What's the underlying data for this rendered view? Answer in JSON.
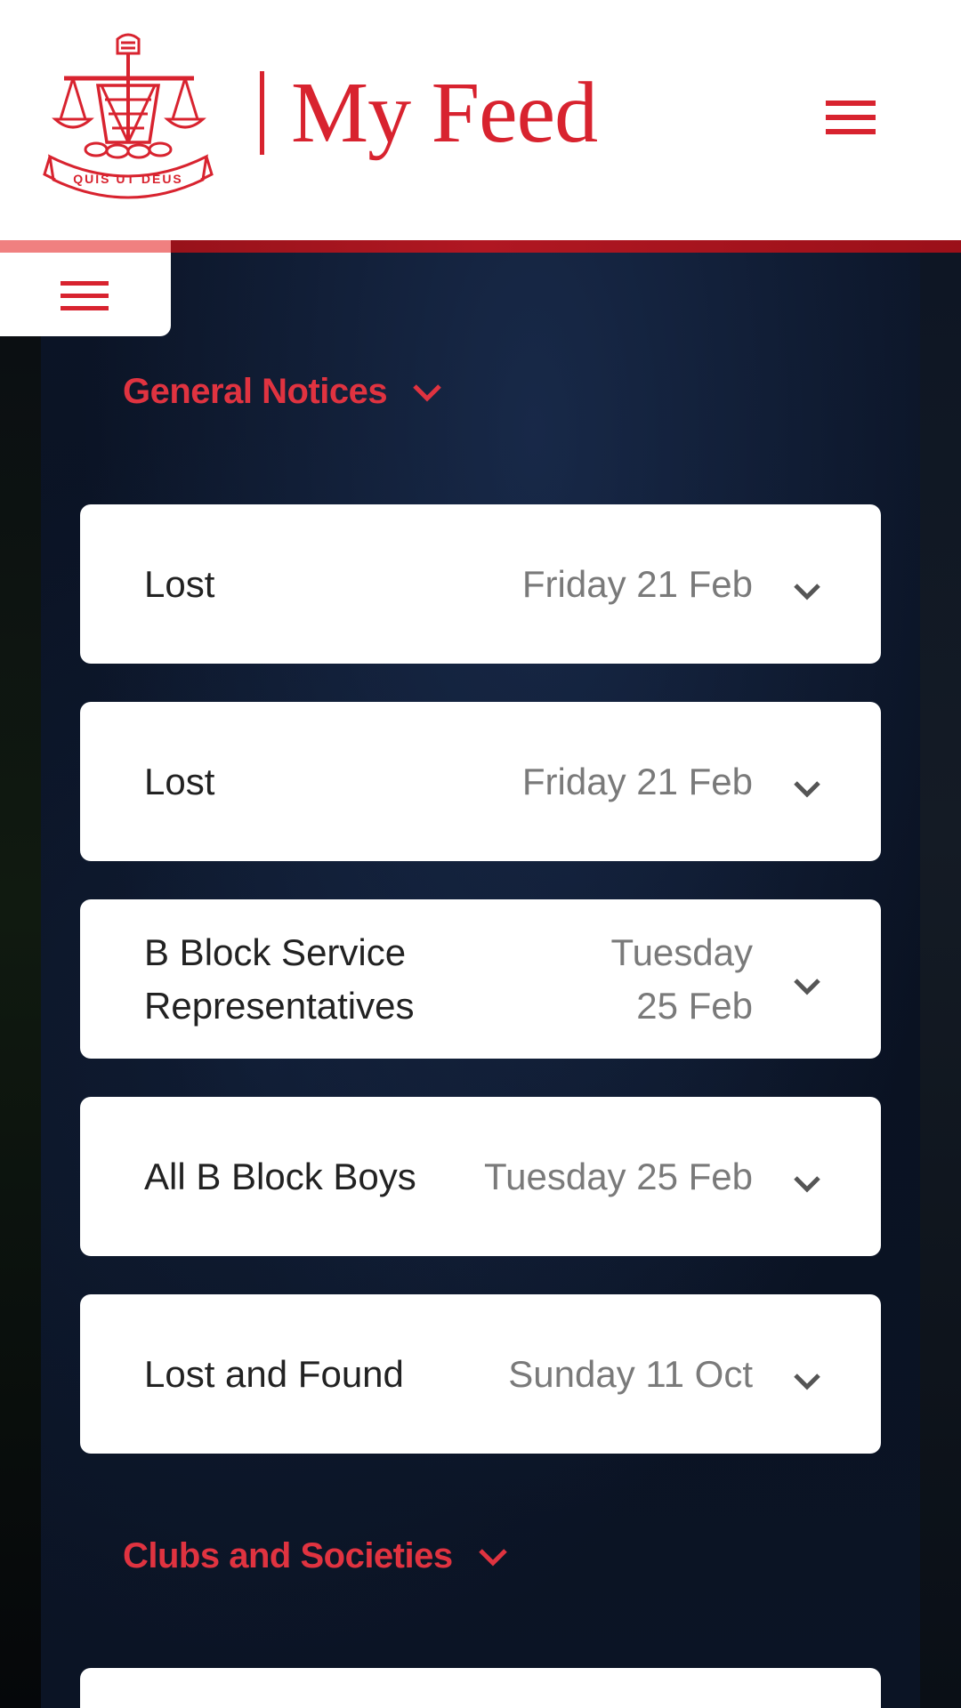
{
  "header": {
    "crest_motto": "QUIS UT DEUS",
    "title": "My Feed",
    "menu_icon": "hamburger-menu-icon"
  },
  "colors": {
    "brand_red": "#d8232f",
    "section_red": "#e03340",
    "background_navy": "#0a1222",
    "card_bg": "#ffffff",
    "title_text": "#222222",
    "date_text": "#7a7a7a"
  },
  "drawer": {
    "icon": "hamburger-menu-icon"
  },
  "sections": [
    {
      "label": "General Notices",
      "icon": "chevron-down-icon",
      "notices": [
        {
          "title": "Lost",
          "date": "Friday 21 Feb"
        },
        {
          "title": "Lost",
          "date": "Friday 21 Feb"
        },
        {
          "title": "B Block Service Representatives",
          "date": "Tuesday 25 Feb"
        },
        {
          "title": "All B Block Boys",
          "date": "Tuesday 25 Feb"
        },
        {
          "title": "Lost and Found",
          "date": "Sunday 11 Oct"
        }
      ]
    },
    {
      "label": "Clubs and Societies",
      "icon": "chevron-down-icon",
      "notices": []
    }
  ]
}
